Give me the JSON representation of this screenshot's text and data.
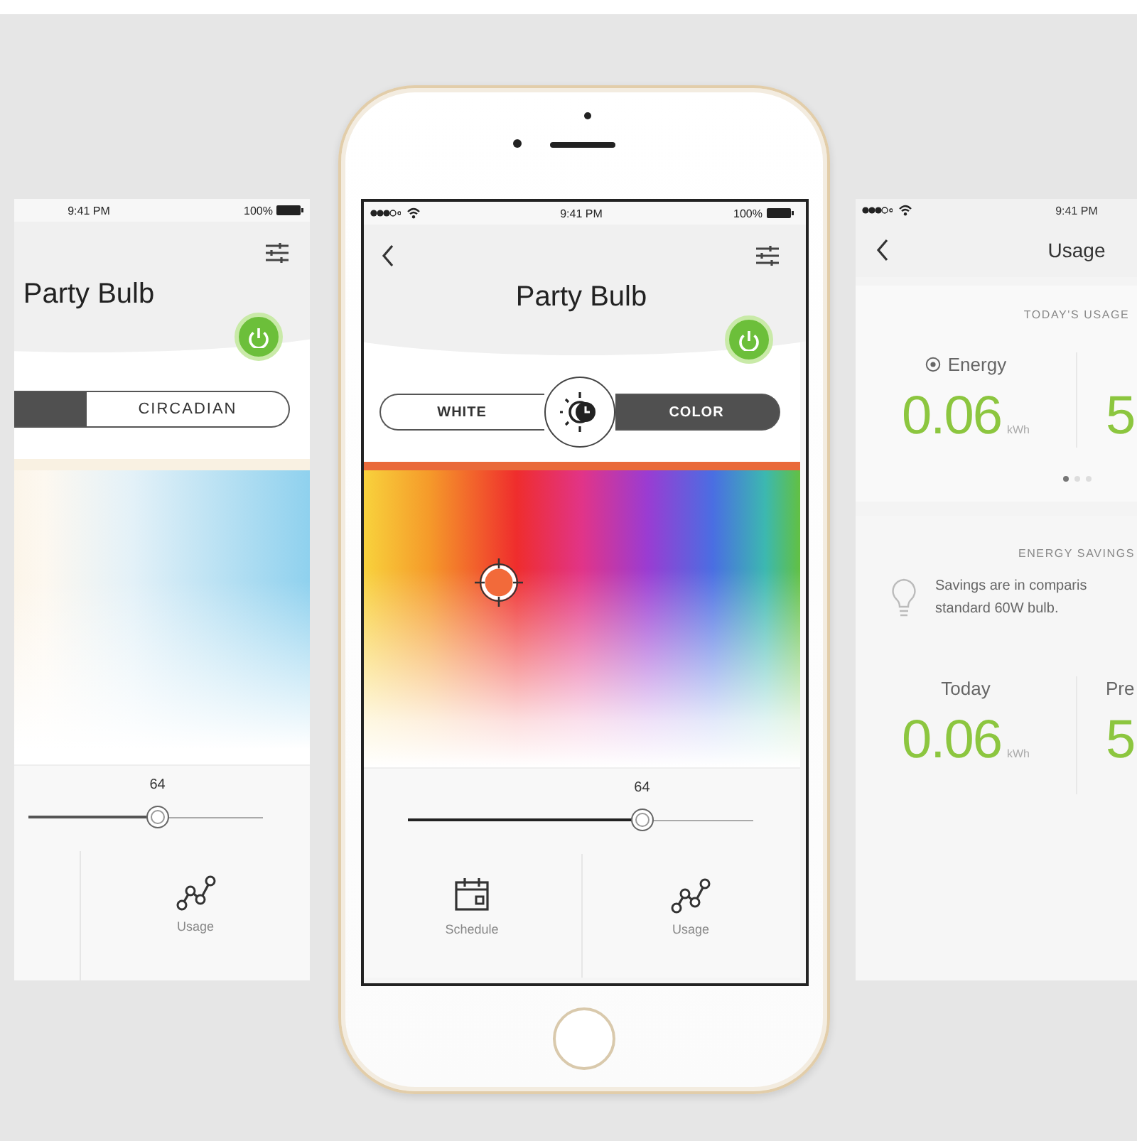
{
  "left_screen": {
    "status_bar": {
      "time": "9:41 PM",
      "battery": "100%"
    },
    "title": "Party Bulb",
    "power_on": true,
    "mode_tabs": [
      {
        "selected": true
      },
      {
        "label": "CIRCADIAN",
        "selected": false
      }
    ],
    "picker": {
      "kind": "white"
    },
    "slider": {
      "reading": "64",
      "level": 0.55
    },
    "nav": [
      {
        "kind": "usage",
        "label": "Usage"
      }
    ]
  },
  "phone": {
    "status_bar": {
      "time": "9:41 PM",
      "battery": "100%"
    },
    "title": "Party Bulb",
    "power_on": true,
    "mode_tabs": [
      {
        "label": "WHITE",
        "selected": false
      },
      {
        "label": "COLOR",
        "selected": true
      }
    ],
    "picker": {
      "kind": "color"
    },
    "slider": {
      "reading": "64",
      "level": 0.68
    },
    "nav": [
      {
        "kind": "schedule",
        "label": "Schedule"
      },
      {
        "kind": "usage",
        "label": "Usage"
      }
    ]
  },
  "right_screen": {
    "status_bar": {
      "time": "9:41 PM"
    },
    "title": "Usage",
    "today": {
      "heading": "TODAY'S USAGE",
      "metrics": [
        {
          "label": "Energy",
          "value": "0.06",
          "unit": "kWh"
        },
        {
          "value": "5"
        }
      ],
      "page_dots": [
        {
          "selected": true
        },
        {
          "selected": false
        },
        {
          "selected": false
        }
      ]
    },
    "savings": {
      "heading": "ENERGY SAVINGS",
      "note_lines": [
        "Savings are in comparis",
        "standard 60W bulb."
      ],
      "metrics": [
        {
          "label": "Today",
          "value": "0.06",
          "unit": "kWh"
        },
        {
          "label": "Pre",
          "value": "5"
        }
      ]
    }
  }
}
